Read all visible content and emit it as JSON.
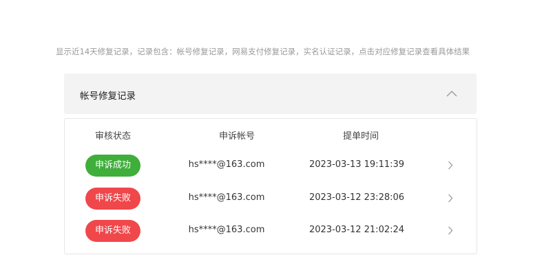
{
  "notice": "显示近14天修复记录，记录包含：帐号修复记录，网易支付修复记录，实名认证记录，点击对应修复记录查看具体结果",
  "section": {
    "title": "帐号修复记录"
  },
  "table": {
    "headers": [
      "审核状态",
      "申诉帐号",
      "提单时间"
    ],
    "rows": [
      {
        "status": "申诉成功",
        "status_type": "success",
        "account": "hs****@163.com",
        "time": "2023-03-13 19:11:39"
      },
      {
        "status": "申诉失败",
        "status_type": "fail",
        "account": "hs****@163.com",
        "time": "2023-03-12 23:28:06"
      },
      {
        "status": "申诉失败",
        "status_type": "fail",
        "account": "hs****@163.com",
        "time": "2023-03-12 21:02:24"
      }
    ]
  },
  "icons": {
    "collapse": "chevron-up-icon",
    "row_open": "chevron-right-icon"
  },
  "colors": {
    "success": "#3fae3b",
    "fail": "#f0474b",
    "header_bg": "#f3f3f3"
  }
}
